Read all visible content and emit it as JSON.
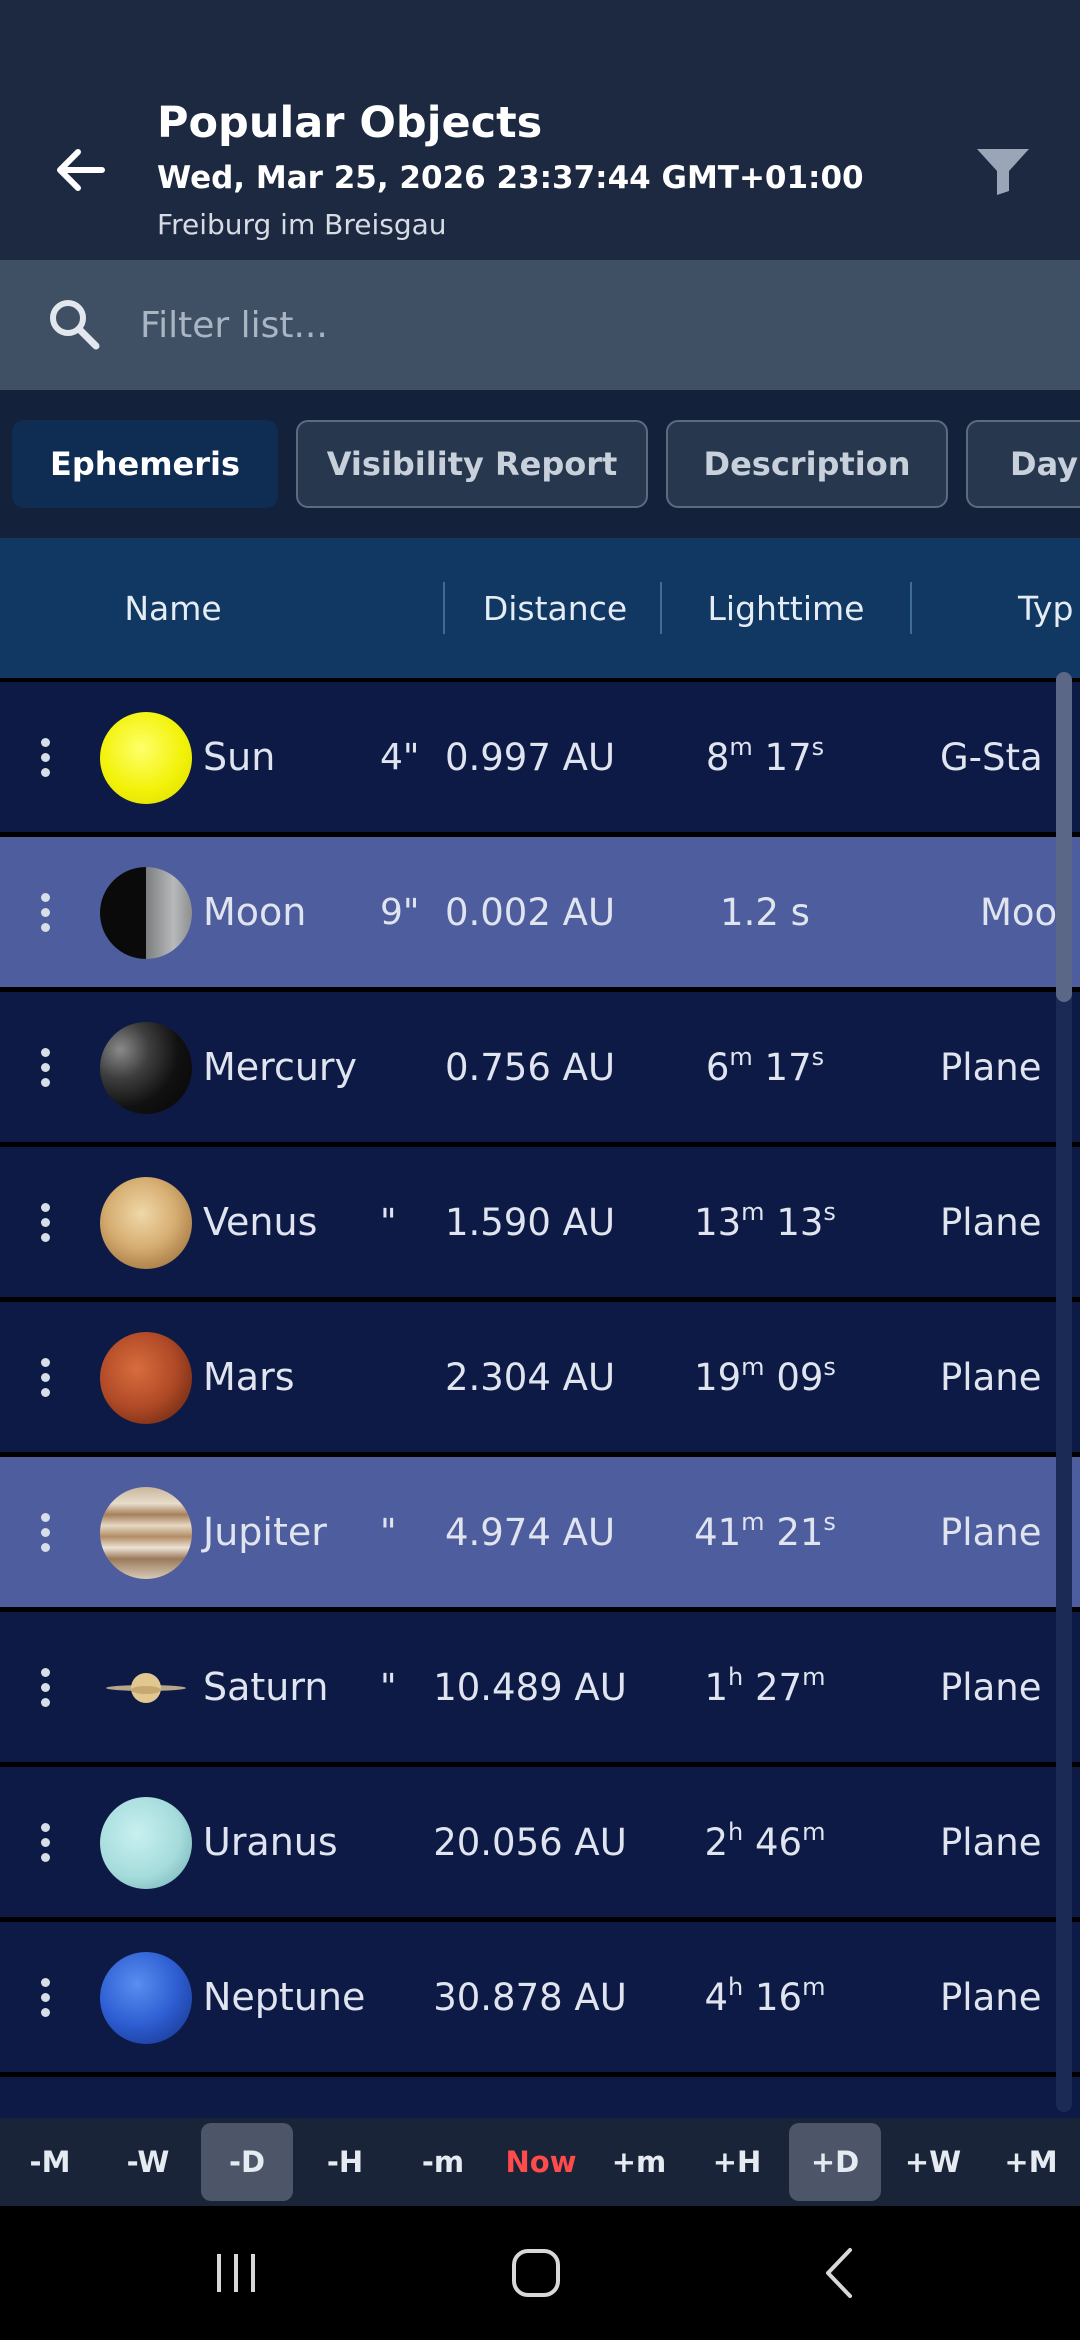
{
  "header": {
    "title": "Popular Objects",
    "datetime": "Wed, Mar 25, 2026 23:37:44 GMT+01:00",
    "location": "Freiburg im Breisgau"
  },
  "search": {
    "placeholder": "Filter list..."
  },
  "tabs": [
    {
      "label": "Ephemeris",
      "active": true
    },
    {
      "label": "Visibility Report",
      "active": false
    },
    {
      "label": "Description",
      "active": false
    },
    {
      "label": "Day",
      "active": false
    }
  ],
  "columns": {
    "name": "Name",
    "distance": "Distance",
    "lighttime": "Lighttime",
    "type": "Typ"
  },
  "rows": [
    {
      "name": "Sun",
      "frag": "4\"",
      "distance": "0.997 AU",
      "lt": [
        [
          "8",
          "m"
        ],
        [
          "17",
          "s"
        ]
      ],
      "type": "G-Sta",
      "highlight": false,
      "icon": "sun-icon"
    },
    {
      "name": "Moon",
      "frag": "9\"",
      "distance": "0.002 AU",
      "lt_text": "1.2 s",
      "type": "Moo",
      "highlight": true,
      "icon": "moon-icon"
    },
    {
      "name": "Mercury",
      "frag": "",
      "distance": "0.756 AU",
      "lt": [
        [
          "6",
          "m"
        ],
        [
          "17",
          "s"
        ]
      ],
      "type": "Plane",
      "highlight": false,
      "icon": "mercury-icon"
    },
    {
      "name": "Venus",
      "frag": "\"",
      "distance": "1.590 AU",
      "lt": [
        [
          "13",
          "m"
        ],
        [
          "13",
          "s"
        ]
      ],
      "type": "Plane",
      "highlight": false,
      "icon": "venus-icon"
    },
    {
      "name": "Mars",
      "frag": "",
      "distance": "2.304 AU",
      "lt": [
        [
          "19",
          "m"
        ],
        [
          "09",
          "s"
        ]
      ],
      "type": "Plane",
      "highlight": false,
      "icon": "mars-icon"
    },
    {
      "name": "Jupiter",
      "frag": "\"",
      "distance": "4.974 AU",
      "lt": [
        [
          "41",
          "m"
        ],
        [
          "21",
          "s"
        ]
      ],
      "type": "Plane",
      "highlight": true,
      "icon": "jupiter-icon"
    },
    {
      "name": "Saturn",
      "frag": "\"",
      "distance": "10.489 AU",
      "lt": [
        [
          "1",
          "h"
        ],
        [
          "27",
          "m"
        ]
      ],
      "type": "Plane",
      "highlight": false,
      "icon": "saturn-icon"
    },
    {
      "name": "Uranus",
      "frag": "",
      "distance": "20.056 AU",
      "lt": [
        [
          "2",
          "h"
        ],
        [
          "46",
          "m"
        ]
      ],
      "type": "Plane",
      "highlight": false,
      "icon": "uranus-icon"
    },
    {
      "name": "Neptune",
      "frag": "",
      "distance": "30.878 AU",
      "lt": [
        [
          "4",
          "h"
        ],
        [
          "16",
          "m"
        ]
      ],
      "type": "Plane",
      "highlight": false,
      "icon": "neptune-icon"
    }
  ],
  "timebar": [
    {
      "label": "-M",
      "selected": false
    },
    {
      "label": "-W",
      "selected": false
    },
    {
      "label": "-D",
      "selected": true
    },
    {
      "label": "-H",
      "selected": false
    },
    {
      "label": "-m",
      "selected": false
    },
    {
      "label": "Now",
      "selected": false,
      "now": true
    },
    {
      "label": "+m",
      "selected": false
    },
    {
      "label": "+H",
      "selected": false
    },
    {
      "label": "+D",
      "selected": true
    },
    {
      "label": "+W",
      "selected": false
    },
    {
      "label": "+M",
      "selected": false
    }
  ],
  "colors": {
    "accent_now": "#ff4b4b",
    "row_bg": "#0d1a45",
    "row_highlight": "#4e5d9e",
    "header_bg": "#1c2940"
  }
}
